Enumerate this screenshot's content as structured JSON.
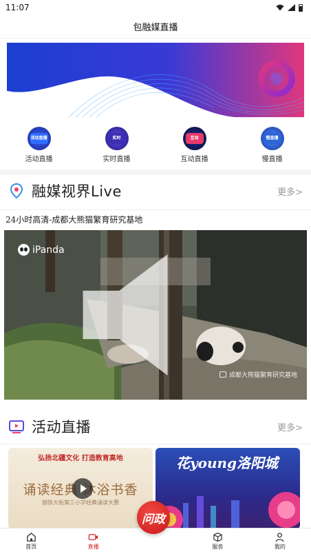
{
  "status_bar": {
    "time": "11:07"
  },
  "header": {
    "title": "包融媒直播"
  },
  "quick_entries": [
    {
      "label": "活动直播",
      "icon": "activity-live-icon",
      "badge": "活动直播",
      "color": "#2a46c8"
    },
    {
      "label": "实时直播",
      "icon": "realtime-live-icon",
      "badge": "实时",
      "color": "#3b2fb5"
    },
    {
      "label": "互动直播",
      "icon": "interactive-live-icon",
      "badge": "互动",
      "color": "#1a2a8a"
    },
    {
      "label": "慢直播",
      "icon": "slow-live-icon",
      "badge": "慢直播",
      "color": "#2d64d8"
    }
  ],
  "section_live": {
    "title": "融媒视界Live",
    "more": "更多>"
  },
  "stream": {
    "title": "24小时高清-成都大熊猫繁育研究基地",
    "logo_text": "iPanda",
    "watermark": "成都大熊猫繁育研究基地"
  },
  "section_activity": {
    "title": "活动直播",
    "more": "更多>"
  },
  "cards": {
    "left": {
      "top": "弘扬北疆文化  打造教育高地",
      "main": "诵读经典 沐浴书香",
      "sub": "钢铁大街第三小学经典诵读大赛"
    },
    "right": {
      "main": "花young洛阳城"
    }
  },
  "fab": {
    "label": "问政"
  },
  "tabs": [
    {
      "label": "首页",
      "icon": "home-icon",
      "active": false
    },
    {
      "label": "直播",
      "icon": "live-icon",
      "active": true
    },
    {
      "label": "",
      "icon": "",
      "active": false
    },
    {
      "label": "服务",
      "icon": "service-box-icon",
      "active": false
    },
    {
      "label": "我的",
      "icon": "profile-icon",
      "active": false
    }
  ],
  "colors": {
    "accent": "#d6262b",
    "banner_blue": "#1b3fd0",
    "banner_pink": "#e0377e"
  }
}
